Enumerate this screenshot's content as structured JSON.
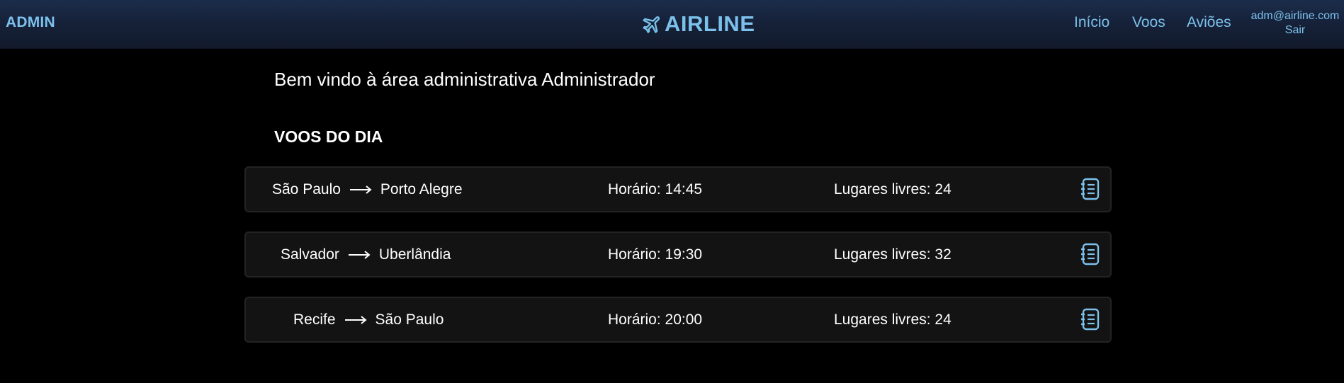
{
  "header": {
    "admin_label": "ADMIN",
    "logo_text": "AIRLINE",
    "logo_icon": "plane-icon",
    "nav": {
      "home": "Início",
      "flights": "Voos",
      "planes": "Aviões"
    },
    "user": {
      "email": "adm@airline.com",
      "logout": "Sair"
    }
  },
  "main": {
    "welcome": "Bem vindo à área administrativa Administrador",
    "section_title": "VOOS DO DIA",
    "flights": [
      {
        "origin": "São Paulo",
        "destination": "Porto Alegre",
        "time": "Horário: 14:45",
        "seats": "Lugares livres: 24"
      },
      {
        "origin": "Salvador",
        "destination": "Uberlândia",
        "time": "Horário: 19:30",
        "seats": "Lugares livres: 32"
      },
      {
        "origin": "Recife",
        "destination": "São Paulo",
        "time": "Horário: 20:00",
        "seats": "Lugares livres: 24"
      }
    ]
  },
  "colors": {
    "accent": "#7cc1ec",
    "header_bg": "#16223a",
    "page_bg": "#000000",
    "card_bg": "#131313"
  }
}
